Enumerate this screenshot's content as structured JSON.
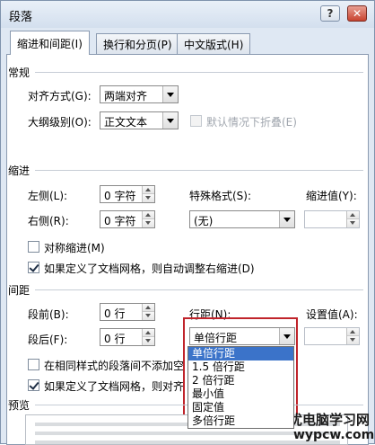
{
  "window": {
    "title": "段落",
    "help_label": "?",
    "close_label": "✕"
  },
  "tabs": [
    {
      "label": "缩进和间距(I)",
      "active": true
    },
    {
      "label": "换行和分页(P)",
      "active": false
    },
    {
      "label": "中文版式(H)",
      "active": false
    }
  ],
  "general": {
    "heading": "常规",
    "alignment_label": "对齐方式(G):",
    "alignment_value": "两端对齐",
    "outline_label": "大纲级别(O):",
    "outline_value": "正文文本",
    "collapse_label": "默认情况下折叠(E)",
    "collapse_checked": false
  },
  "indent": {
    "heading": "缩进",
    "left_label": "左侧(L):",
    "left_value": "0 字符",
    "right_label": "右侧(R):",
    "right_value": "0 字符",
    "special_label": "特殊格式(S):",
    "special_value": "(无)",
    "by_label": "缩进值(Y):",
    "by_value": "",
    "mirror_label": "对称缩进(M)",
    "mirror_checked": false,
    "autoadjust_label": "如果定义了文档网格，则自动调整右缩进(D)",
    "autoadjust_checked": true
  },
  "spacing": {
    "heading": "间距",
    "before_label": "段前(B):",
    "before_value": "0 行",
    "after_label": "段后(F):",
    "after_value": "0 行",
    "line_label": "行距(N):",
    "line_value": "单倍行距",
    "at_label": "设置值(A):",
    "at_value": "",
    "nospace_label": "在相同样式的段落间不添加空",
    "nospace_checked": false,
    "snap_label": "如果定义了文档网格，则对齐",
    "snap_checked": true,
    "line_options": [
      "单倍行距",
      "1.5 倍行距",
      "2 倍行距",
      "最小值",
      "固定值",
      "多倍行距"
    ],
    "line_selected_index": 0
  },
  "preview": {
    "heading": "预览"
  },
  "watermark": {
    "line1": "无忧电脑学习网",
    "line2": "wypcw.com"
  },
  "colors": {
    "highlight_border": "#c0242b",
    "selection": "#3b73c9"
  }
}
